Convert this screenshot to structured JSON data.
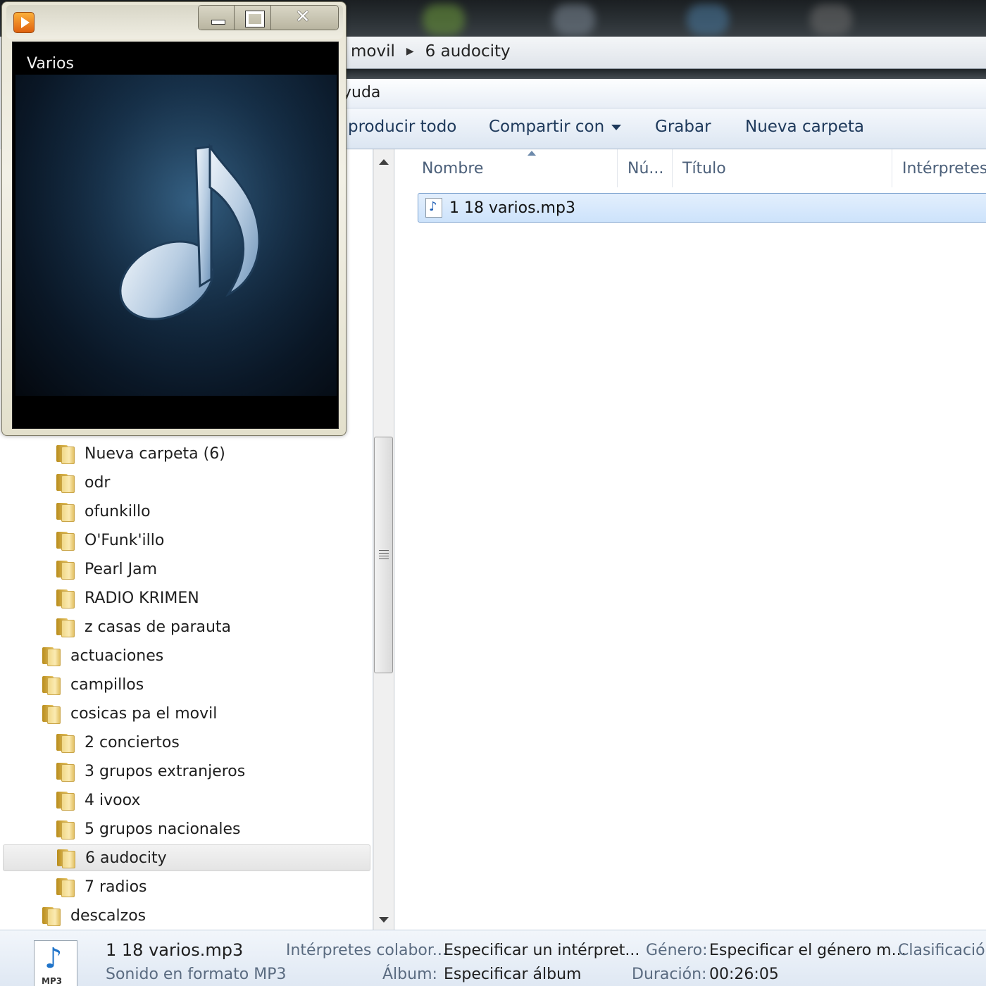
{
  "explorer": {
    "breadcrumb": [
      "movil",
      "6 audocity"
    ],
    "menu_partial": "yuda",
    "toolbar": {
      "play_all": "producir todo",
      "share": "Compartir con",
      "burn": "Grabar",
      "new_folder": "Nueva carpeta"
    },
    "nav_items": [
      {
        "label": "Nueva carpeta (6)",
        "indent": 2
      },
      {
        "label": "odr",
        "indent": 2
      },
      {
        "label": "ofunkillo",
        "indent": 2
      },
      {
        "label": "O'Funk'illo",
        "indent": 2
      },
      {
        "label": "Pearl Jam",
        "indent": 2
      },
      {
        "label": "RADIO KRIMEN",
        "indent": 2
      },
      {
        "label": "z casas de parauta",
        "indent": 2
      },
      {
        "label": "actuaciones",
        "indent": 1
      },
      {
        "label": "campillos",
        "indent": 1
      },
      {
        "label": "cosicas pa el movil",
        "indent": 1
      },
      {
        "label": "2 conciertos",
        "indent": 2
      },
      {
        "label": "3 grupos extranjeros",
        "indent": 2
      },
      {
        "label": "4 ivoox",
        "indent": 2
      },
      {
        "label": "5 grupos nacionales",
        "indent": 2
      },
      {
        "label": "6 audocity",
        "indent": 2,
        "selected": true
      },
      {
        "label": "7 radios",
        "indent": 2
      },
      {
        "label": "descalzos",
        "indent": 1
      }
    ],
    "columns": {
      "name": "Nombre",
      "number": "Nú...",
      "title": "Título",
      "artists": "Intérpretes c"
    },
    "files": [
      {
        "name": "1 18 varios.mp3",
        "icon": "mp3-file-icon"
      }
    ],
    "details": {
      "file_name": "1 18 varios.mp3",
      "file_type": "Sonido en formato MP3",
      "icon_tag": "MP3",
      "contributing_artists_label": "Intérpretes colabor...",
      "contributing_artists_value": "Especificar un intérpret...",
      "album_label": "Álbum:",
      "album_value": "Especificar álbum",
      "genre_label": "Género:",
      "genre_value": "Especificar el género m...",
      "duration_label": "Duración:",
      "duration_value": "00:26:05",
      "rating_label": "Clasificación"
    }
  },
  "player": {
    "album_title": "Varios",
    "art_icon": "music-note-icon",
    "colors": {
      "note_light": "#dfe9f4",
      "note_dark": "#7fa3c7",
      "art_bg": "#163049"
    }
  }
}
